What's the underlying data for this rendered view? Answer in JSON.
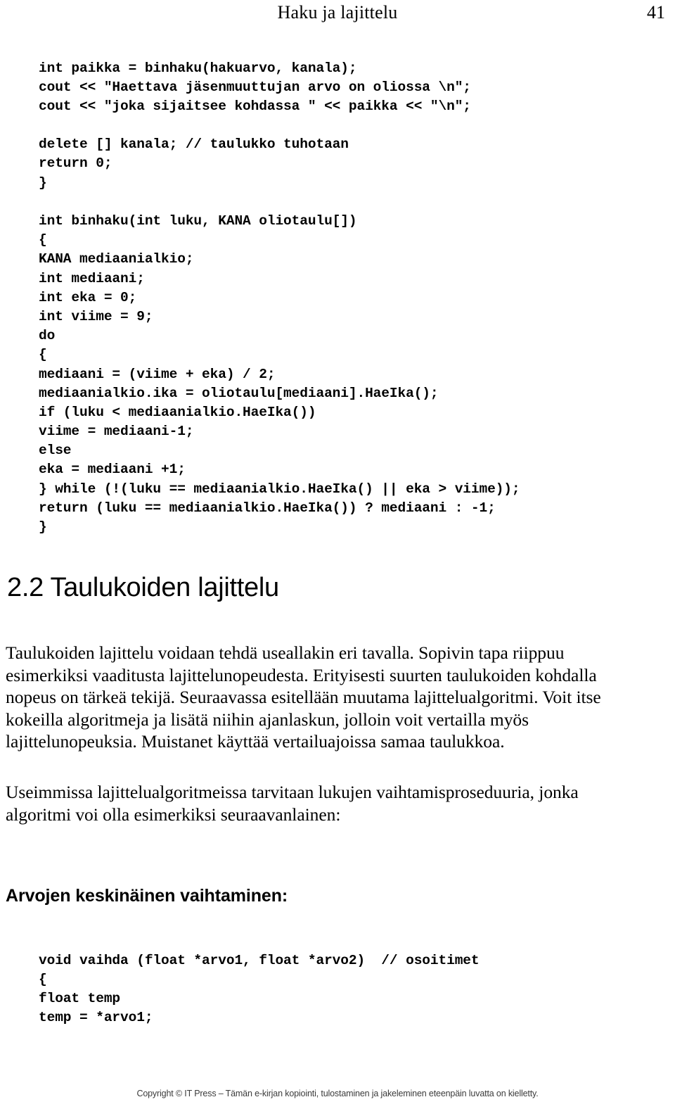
{
  "header": {
    "running_title": "Haku ja lajittelu",
    "page_number": "41"
  },
  "code_main": {
    "lines": [
      "int paikka = binhaku(hakuarvo, kanala);",
      "cout << \"Haettava jäsenmuuttujan arvo on oliossa \\n\";",
      "cout << \"joka sijaitsee kohdassa \" << paikka << \"\\n\";",
      "",
      "delete [] kanala; // taulukko tuhotaan",
      "return 0;",
      "}",
      "",
      "int binhaku(int luku, KANA oliotaulu[])",
      "{",
      "KANA mediaanialkio;",
      "int mediaani;",
      "int eka = 0;",
      "int viime = 9;",
      "do",
      "{",
      "mediaani = (viime + eka) / 2;",
      "mediaanialkio.ika = oliotaulu[mediaani].HaeIka();",
      "if (luku < mediaanialkio.HaeIka())",
      "viime = mediaani-1;",
      "else",
      "eka = mediaani +1;",
      "} while (!(luku == mediaanialkio.HaeIka() || eka > viime));",
      "return (luku == mediaanialkio.HaeIka()) ? mediaani : -1;",
      "}"
    ]
  },
  "section": {
    "heading": "2.2 Taulukoiden lajittelu"
  },
  "paragraphs": {
    "p1": "Taulukoiden lajittelu voidaan tehdä useallakin eri tavalla. Sopivin tapa riippuu esimerkiksi vaaditusta lajittelunopeudesta. Erityisesti suurten taulukoiden kohdalla nopeus on tärkeä tekijä. Seuraavassa esitellään muutama lajittelualgoritmi. Voit itse kokeilla algoritmeja ja lisätä niihin ajanlaskun, jolloin voit vertailla myös lajittelunopeuksia. Muistanet käyttää vertailuajoissa samaa taulukkoa.",
    "p2": "Useimmissa lajittelualgoritmeissa tarvitaan lukujen vaihtamisproseduuria, jonka algoritmi voi olla esimerkiksi seuraavanlainen:"
  },
  "sub_heading": {
    "text": "Arvojen keskinäinen vaihtaminen:"
  },
  "code_swap": {
    "lines": [
      "void vaihda (float *arvo1, float *arvo2)  // osoitimet",
      "{",
      "float temp",
      "temp = *arvo1;"
    ]
  },
  "footer": {
    "copyright": "Copyright © IT Press – Tämän e-kirjan kopiointi, tulostaminen ja jakeleminen eteenpäin luvatta on kielletty."
  }
}
